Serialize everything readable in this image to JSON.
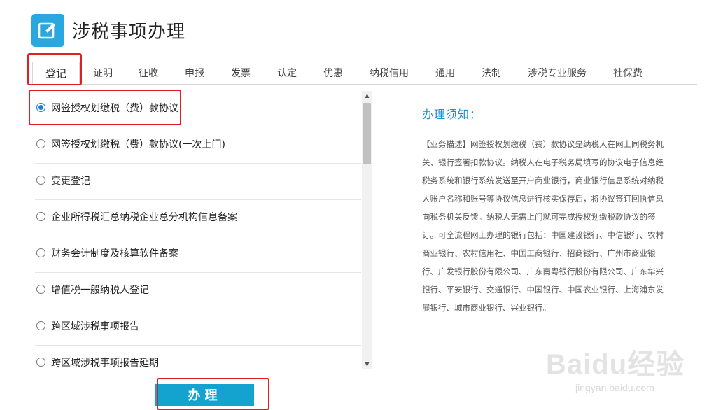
{
  "header": {
    "title": "涉税事项办理",
    "icon": "edit-icon",
    "accent_color": "#29a8e0"
  },
  "tabs": [
    {
      "label": "登记",
      "active": true
    },
    {
      "label": "证明",
      "active": false
    },
    {
      "label": "征收",
      "active": false
    },
    {
      "label": "申报",
      "active": false
    },
    {
      "label": "发票",
      "active": false
    },
    {
      "label": "认定",
      "active": false
    },
    {
      "label": "优惠",
      "active": false
    },
    {
      "label": "纳税信用",
      "active": false
    },
    {
      "label": "通用",
      "active": false
    },
    {
      "label": "法制",
      "active": false
    },
    {
      "label": "涉税专业服务",
      "active": false
    },
    {
      "label": "社保费",
      "active": false
    }
  ],
  "items": [
    {
      "label": "网签授权划缴税（费）款协议",
      "selected": true
    },
    {
      "label": "网签授权划缴税（费）款协议(一次上门)",
      "selected": false
    },
    {
      "label": "变更登记",
      "selected": false
    },
    {
      "label": "企业所得税汇总纳税企业总分机构信息备案",
      "selected": false
    },
    {
      "label": "财务会计制度及核算软件备案",
      "selected": false
    },
    {
      "label": "增值税一般纳税人登记",
      "selected": false
    },
    {
      "label": "跨区域涉税事项报告",
      "selected": false
    },
    {
      "label": "跨区域涉税事项报告延期",
      "selected": false
    }
  ],
  "submit": {
    "label": "办理",
    "color": "#14a3cf"
  },
  "notice": {
    "title": "办理须知：",
    "body": "【业务描述】网签授权划缴税（费）款协议是纳税人在网上同税务机关、银行签署扣款协议。纳税人在电子税务局填写的协议电子信息经税务系统和银行系统发送至开户商业银行，商业银行信息系统对纳税人账户名称和账号等协议信息进行核实保存后，将协议签订回执信息向税务机关反馈。纳税人无需上门就可完成授权划缴税款协议的签订。可全流程网上办理的银行包括：中国建设银行、中信银行、农村商业银行、农村信用社、中国工商银行、招商银行、广州市商业银行、广发银行股份有限公司、广东南粤银行股份有限公司、广东华兴银行、平安银行、交通银行、中国银行、中国农业银行、上海浦东发展银行、城市商业银行、兴业银行。"
  },
  "watermark": {
    "logo": "Baidu经验",
    "url": "jingyan.baidu.com"
  },
  "annotation_color": "#e02020"
}
